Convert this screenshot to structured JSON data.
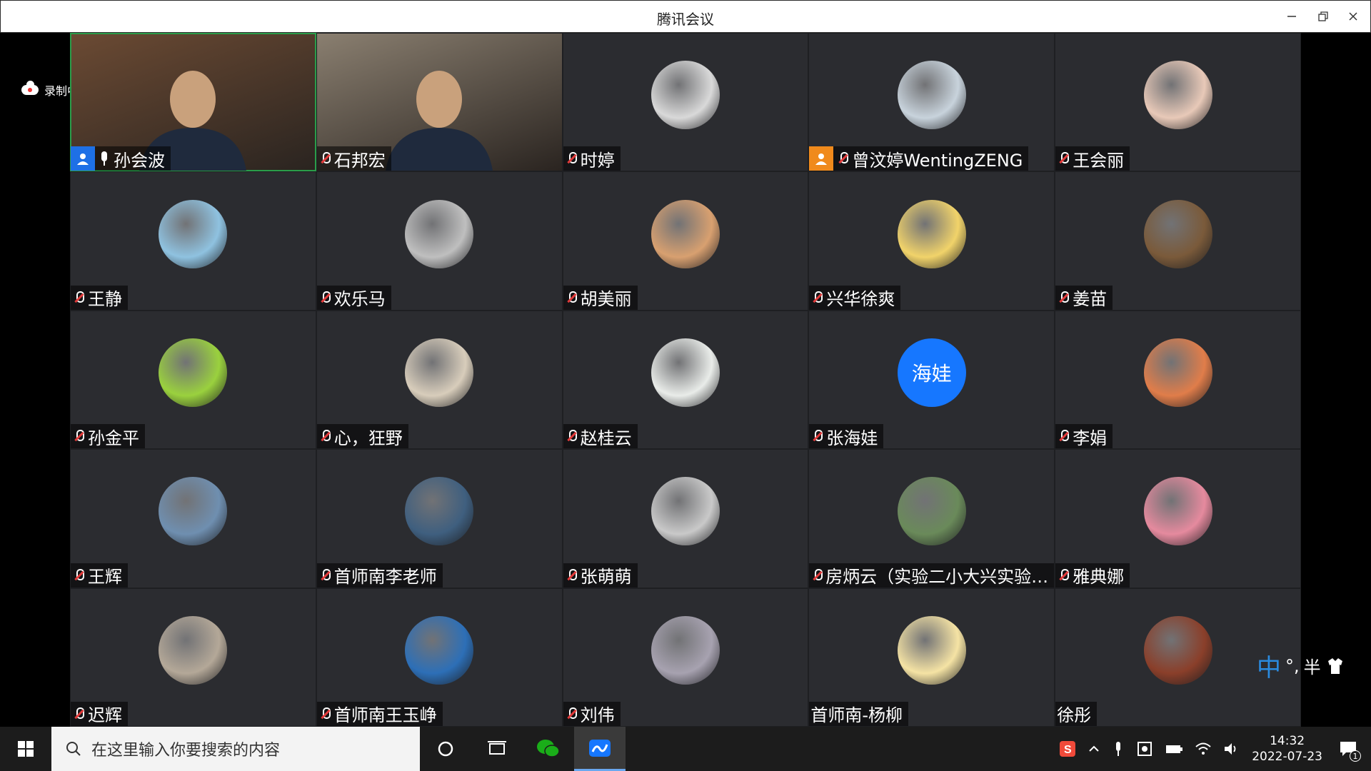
{
  "window": {
    "title": "腾讯会议",
    "minimize_icon": "minimize-icon",
    "restore_icon": "restore-icon",
    "close_icon": "close-icon"
  },
  "recording": {
    "label": "录制中"
  },
  "participants": [
    {
      "name": "孙会波",
      "mode": "video",
      "host": true,
      "mic": "on",
      "color": "#6b4a33"
    },
    {
      "name": "石邦宏",
      "mode": "video",
      "mic": "muted",
      "color": "#8a7f70"
    },
    {
      "name": "时婷",
      "mode": "avatar",
      "mic": "muted",
      "color": "#d9d9d9"
    },
    {
      "name": "曾汶婷WentingZENG",
      "mode": "avatar",
      "cohost": true,
      "mic": "muted",
      "color": "#c8d3dc"
    },
    {
      "name": "王会丽",
      "mode": "avatar",
      "mic": "muted",
      "color": "#e8c9b8"
    },
    {
      "name": "王静",
      "mode": "avatar",
      "mic": "muted",
      "color": "#8fc2e0"
    },
    {
      "name": "欢乐马",
      "mode": "avatar",
      "mic": "muted",
      "color": "#bfbfbf"
    },
    {
      "name": "胡美丽",
      "mode": "avatar",
      "mic": "muted",
      "color": "#d8a070"
    },
    {
      "name": "兴华徐爽",
      "mode": "avatar",
      "mic": "muted",
      "color": "#f1d36a"
    },
    {
      "name": "姜苗",
      "mode": "avatar",
      "mic": "muted",
      "color": "#7a5a3a"
    },
    {
      "name": "孙金平",
      "mode": "avatar",
      "mic": "muted",
      "color": "#9ad13e"
    },
    {
      "name": "心，狂野",
      "mode": "avatar",
      "mic": "muted",
      "color": "#d8cdbb"
    },
    {
      "name": "赵桂云",
      "mode": "avatar",
      "mic": "muted",
      "color": "#e9ece9"
    },
    {
      "name": "张海娃",
      "mode": "initials",
      "initials": "海娃",
      "mic": "muted",
      "color": "#1677ff"
    },
    {
      "name": "李娟",
      "mode": "avatar",
      "mic": "muted",
      "color": "#e07d4a"
    },
    {
      "name": "王辉",
      "mode": "avatar",
      "mic": "muted",
      "color": "#6f8fb0"
    },
    {
      "name": "首师南李老师",
      "mode": "avatar",
      "mic": "muted",
      "color": "#3f5f7f"
    },
    {
      "name": "张萌萌",
      "mode": "avatar",
      "mic": "muted",
      "color": "#c9c9c9"
    },
    {
      "name": "房炳云（实验二小大兴实验…",
      "mode": "avatar",
      "mic": "muted",
      "color": "#6a8a5a"
    },
    {
      "name": "雅典娜",
      "mode": "avatar",
      "mic": "muted",
      "color": "#e58a9e"
    },
    {
      "name": "迟辉",
      "mode": "avatar",
      "mic": "muted",
      "color": "#b4a898"
    },
    {
      "name": "首师南王玉峥",
      "mode": "avatar",
      "mic": "muted",
      "color": "#2d6fb7"
    },
    {
      "name": "刘伟",
      "mode": "avatar",
      "mic": "muted",
      "color": "#a7a2b0"
    },
    {
      "name": "首师南-杨柳",
      "mode": "avatar",
      "mic": "none",
      "color": "#f5e3a4"
    },
    {
      "name": "徐彤",
      "mode": "avatar",
      "mic": "none",
      "color": "#8a3f2a"
    }
  ],
  "ime": {
    "lang": "中",
    "punct": "°,",
    "width": "半"
  },
  "taskbar": {
    "search_placeholder": "在这里输入你要搜索的内容",
    "clock_time": "14:32",
    "clock_date": "2022-07-23",
    "notification_count": "1"
  }
}
